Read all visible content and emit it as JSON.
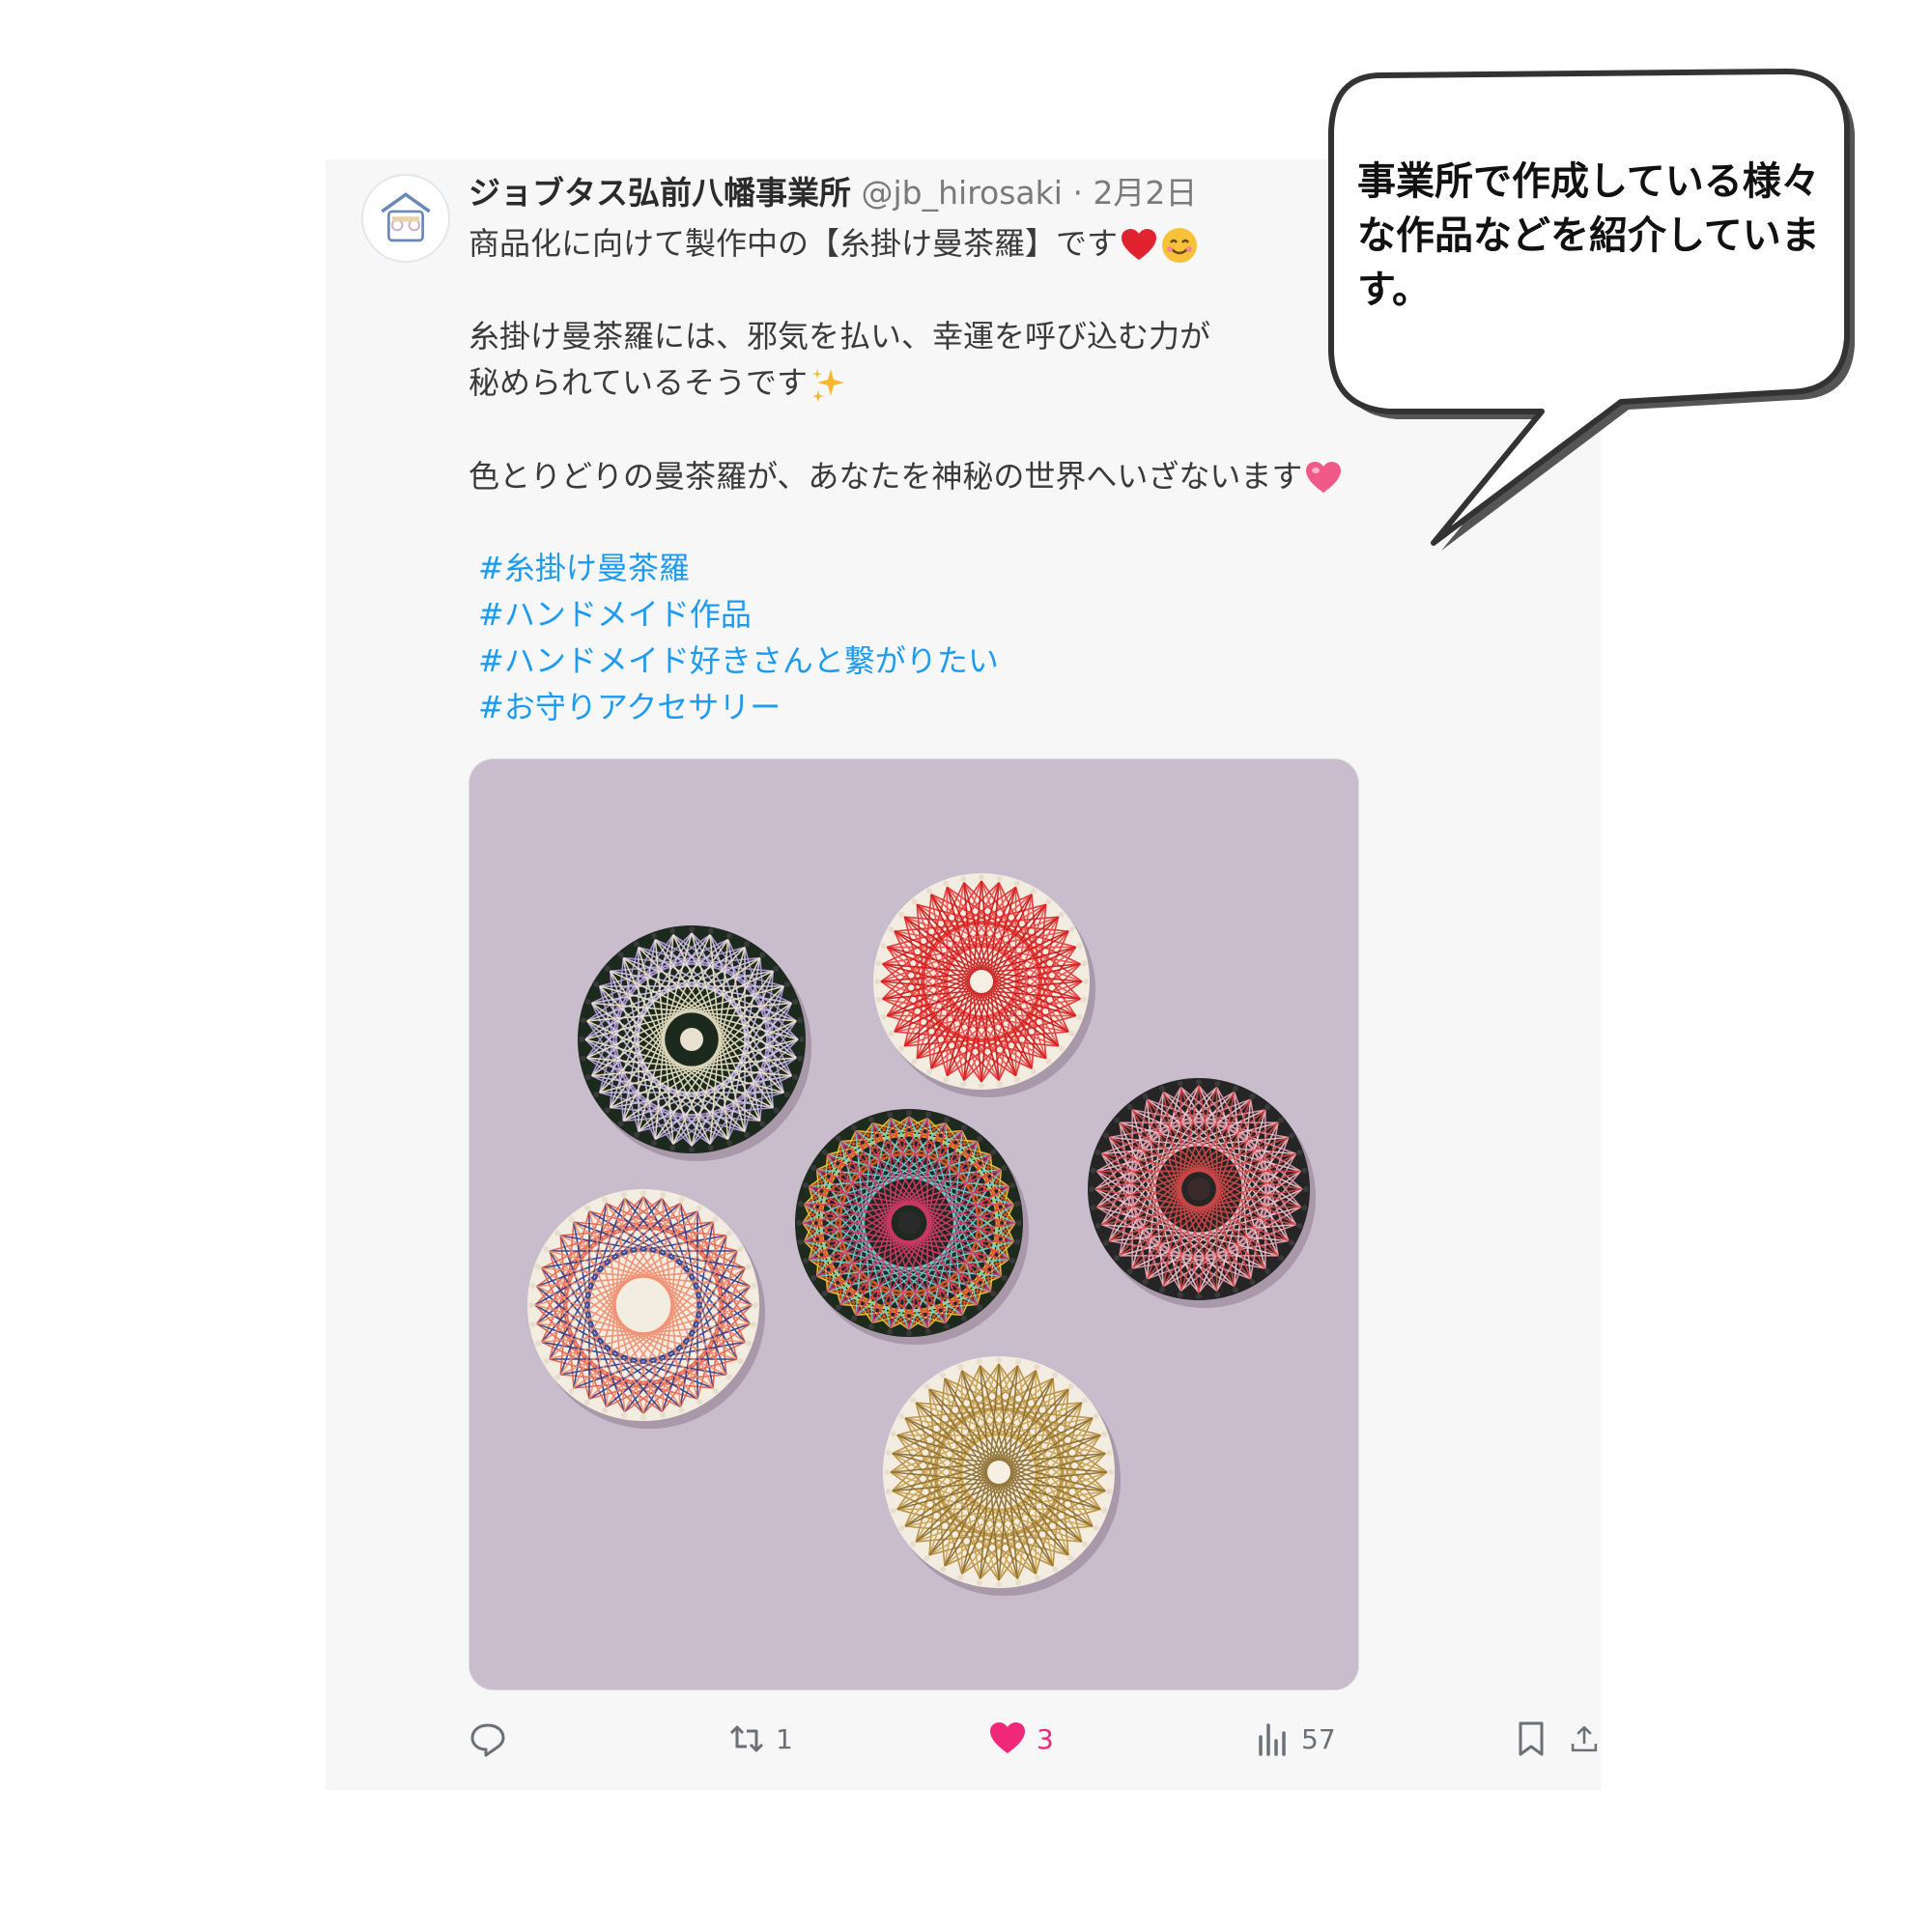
{
  "tweet": {
    "display_name": "ジョブタス弘前八幡事業所",
    "handle": "@jb_hirosaki",
    "separator": "·",
    "date": "2月2日",
    "lines": [
      "商品化に向けて製作中の【糸掛け曼茶羅】です",
      "糸掛け曼茶羅には、邪気を払い、幸運を呼び込む力が",
      "秘められているそうです",
      "色とりどりの曼茶羅が、あなたを神秘の世界へいざないます"
    ],
    "hashtags": [
      "#糸掛け曼茶羅",
      "#ハンドメイド作品",
      "#ハンドメイド好きさんと繋がりたい",
      "#お守りアクセサリー"
    ],
    "emojis": [
      "red-heart",
      "smiling-face",
      "sparkles",
      "pink-heart"
    ]
  },
  "actions": {
    "reply_count": "",
    "retweet_count": "1",
    "like_count": "3",
    "views_count": "57"
  },
  "callout": {
    "text": "事業所で作成している様々な作品などを紹介しています。"
  },
  "colors": {
    "hashtag": "#1d9bf0",
    "like": "#f0287a",
    "card_background": "#f7f7f8",
    "photo_background": "#c9bccd"
  }
}
